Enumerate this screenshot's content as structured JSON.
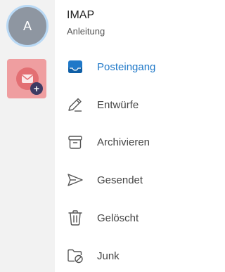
{
  "rail": {
    "avatar_initial": "A"
  },
  "account": {
    "name": "IMAP",
    "subtitle": "Anleitung"
  },
  "folders": [
    {
      "label": "Posteingang",
      "icon": "inbox-icon"
    },
    {
      "label": "Entwürfe",
      "icon": "pencil-icon"
    },
    {
      "label": "Archivieren",
      "icon": "archive-icon"
    },
    {
      "label": "Gesendet",
      "icon": "send-icon"
    },
    {
      "label": "Gelöscht",
      "icon": "trash-icon"
    },
    {
      "label": "Junk",
      "icon": "junk-folder-icon"
    }
  ],
  "colors": {
    "accent": "#1f78c8",
    "rail_bg": "#f2f2f2",
    "add_account_bg": "#ef9ea0"
  }
}
